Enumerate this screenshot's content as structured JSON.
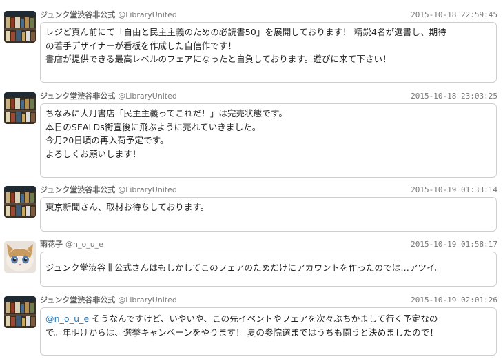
{
  "tweets": [
    {
      "author": "ジュンク堂渋谷非公式",
      "handle": "@LibraryUnited",
      "timestamp": "2015-10-18 22:59:45",
      "avatar": "bookstore-avatar",
      "lines": [
        "レジど真ん前にて「自由と民主主義のための必読書50」を展開しております！ 精鋭4名が選書し、期待",
        "の若手デザイナーが看板を作成した自信作です！",
        "書店が提供できる最高レベルのフェアになったと自負しております。遊びに来て下さい！"
      ]
    },
    {
      "author": "ジュンク堂渋谷非公式",
      "handle": "@LibraryUnited",
      "timestamp": "2015-10-18 23:03:25",
      "avatar": "bookstore-avatar",
      "lines": [
        "ちなみに大月書店「民主主義ってこれだ！」は完売状態です。",
        "本日のSEALDs街宣後に飛ぶように売れていきました。",
        "今月20日頃の再入荷予定です。",
        "よろしくお願いします！"
      ]
    },
    {
      "author": "ジュンク堂渋谷非公式",
      "handle": "@LibraryUnited",
      "timestamp": "2015-10-19 01:33:14",
      "avatar": "bookstore-avatar",
      "lines": [
        "東京新聞さん、取材お待ちしております。"
      ]
    },
    {
      "author": "雨花子",
      "handle": "@n_o_u_e",
      "timestamp": "2015-10-19 01:58:17",
      "avatar": "cat-avatar",
      "lines": [
        "ジュンク堂渋谷非公式さんはもしかしてこのフェアのためだけにアカウントを作ったのでは…アツイ。"
      ]
    },
    {
      "author": "ジュンク堂渋谷非公式",
      "handle": "@LibraryUnited",
      "timestamp": "2015-10-19 02:01:26",
      "avatar": "bookstore-avatar",
      "mention": "@n_o_u_e",
      "lines": [
        " そうなんですけど、いやいや、この先イベントやフェアを次々ぶちかまして行く予定なの",
        "で。年明けからは、選挙キャンペーンをやります！ 夏の参院選まではうちも闘うと決めましたので！"
      ]
    }
  ],
  "colors": {
    "mention": "#2b7bb9",
    "border": "#cfcfcf",
    "meta": "#777777"
  }
}
